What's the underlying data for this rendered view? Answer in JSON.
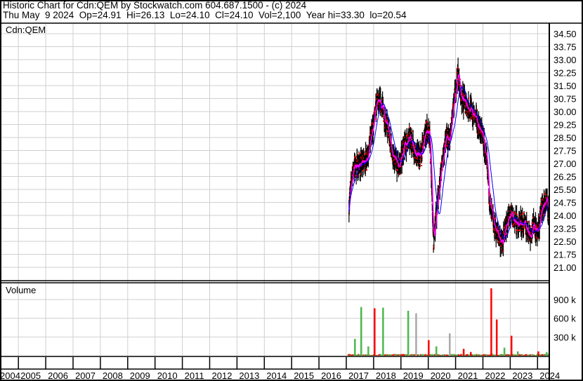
{
  "header": {
    "title": "Historic Chart for Cdn:QEM by Stockwatch.com 604.687.1500 - (c) 2024",
    "quote": "Thu May  9 2024  Op=24.91  Hi=26.13  Lo=24.10  Cl=24.10  Vol=2,100  Year hi=33.30  lo=20.54"
  },
  "chart_data": [
    {
      "type": "scatter",
      "title": "Cdn:QEM",
      "ylim": [
        20.54,
        34.5
      ],
      "y_ticks": [
        "34.50",
        "33.75",
        "33.00",
        "32.25",
        "31.50",
        "30.75",
        "30.00",
        "29.25",
        "28.50",
        "27.75",
        "27.00",
        "26.25",
        "25.50",
        "24.75",
        "24.00",
        "23.25",
        "22.50",
        "21.75",
        "21.00"
      ],
      "grid": true,
      "series": [
        {
          "name": "price",
          "color": "#000000",
          "x": [
            2017.1,
            2017.26,
            2017.57,
            2017.75,
            2017.95,
            2018.13,
            2018.34,
            2018.52,
            2018.72,
            2018.93,
            2019.11,
            2019.37,
            2019.55,
            2019.75,
            2019.93,
            2020.06,
            2020.19,
            2020.32,
            2020.47,
            2020.65,
            2020.78,
            2020.91,
            2021.09,
            2021.19,
            2021.34,
            2021.6,
            2021.81,
            2022.01,
            2022.14,
            2022.27,
            2022.4,
            2022.58,
            2022.73,
            2022.84,
            2023.04,
            2023.22,
            2023.4,
            2023.61,
            2023.74,
            2023.86,
            2024.02,
            2024.17,
            2024.33,
            2024.4
          ],
          "y": [
            24.7,
            26.8,
            27.0,
            27.3,
            28.8,
            30.6,
            30.2,
            29.0,
            27.3,
            26.8,
            28.0,
            28.5,
            27.5,
            27.5,
            29.0,
            28.5,
            22.5,
            24.5,
            26.5,
            28.5,
            28.2,
            30.0,
            32.3,
            31.0,
            30.5,
            30.0,
            29.3,
            28.5,
            27.0,
            24.5,
            23.5,
            22.8,
            22.3,
            23.5,
            24.0,
            23.5,
            23.6,
            23.3,
            22.8,
            23.5,
            23.0,
            24.5,
            24.8,
            24.1
          ]
        },
        {
          "name": "short moving average",
          "color": "#ff00ff"
        },
        {
          "name": "long moving average",
          "color": "#0000ff"
        }
      ]
    },
    {
      "type": "bar",
      "title": "Volume",
      "y_ticks": [
        "900 k",
        "600 k",
        "300 k"
      ],
      "ylim": [
        0,
        1100000
      ],
      "x": [
        2017.31,
        2017.54,
        2017.8,
        2018.03,
        2018.34,
        2019.26,
        2019.55,
        2020.01,
        2020.29,
        2020.78,
        2021.29,
        2021.55,
        2022.3,
        2022.5,
        2022.78,
        2023.04,
        2023.27,
        2024.02,
        2024.33
      ],
      "values": [
        270000,
        780000,
        150000,
        760000,
        770000,
        720000,
        680000,
        250000,
        150000,
        360000,
        110000,
        60000,
        1080000,
        580000,
        130000,
        320000,
        70000,
        70000,
        60000
      ],
      "colors": [
        "#4cb84c",
        "#4cb84c",
        "#4cb84c",
        "#ff0000",
        "#4cb84c",
        "#4cb84c",
        "#a8a8a8",
        "#ff0000",
        "#4cb84c",
        "#a8a8a8",
        "#ff0000",
        "#ff0000",
        "#ff0000",
        "#ff0000",
        "#4cb84c",
        "#ff0000",
        "#4cb84c",
        "#ff0000",
        "#4cb84c"
      ]
    }
  ],
  "x_axis": {
    "years": [
      "2004",
      "2005",
      "2006",
      "2007",
      "2008",
      "2009",
      "2010",
      "2011",
      "2012",
      "2013",
      "2014",
      "2015",
      "2016",
      "2017",
      "2018",
      "2019",
      "2020",
      "2021",
      "2022",
      "2023",
      "2024"
    ]
  }
}
